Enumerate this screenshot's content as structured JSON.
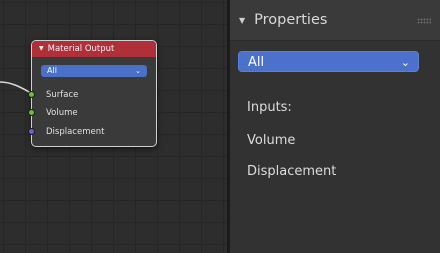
{
  "node": {
    "title": "Material Output",
    "target_select": "All",
    "sockets": [
      {
        "label": "Surface",
        "color": "#61c33c"
      },
      {
        "label": "Volume",
        "color": "#61c33c"
      },
      {
        "label": "Displacement",
        "color": "#6565d1"
      }
    ],
    "header_color": "#b0303a"
  },
  "panel": {
    "title": "Properties",
    "target_select": "All",
    "inputs_label": "Inputs:",
    "items": [
      "Volume",
      "Displacement"
    ]
  },
  "colors": {
    "accent_blue": "#4b71cd",
    "panel_bg": "#323232",
    "editor_bg": "#2d2d2d"
  },
  "icons": {
    "collapse": "triangle-down-icon",
    "dropdown": "chevron-down-icon",
    "drag": "grip-icon"
  }
}
